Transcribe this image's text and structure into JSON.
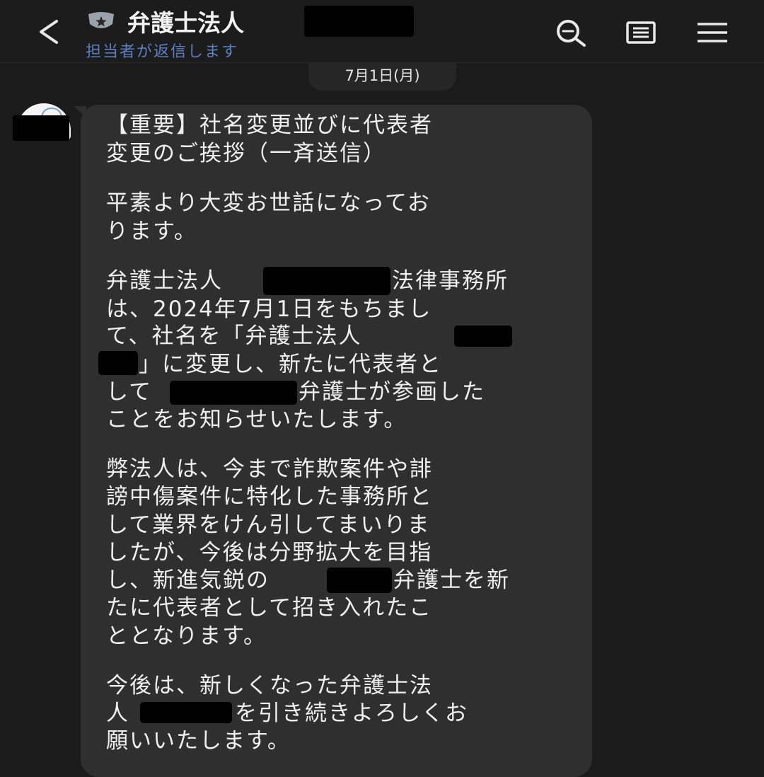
{
  "header": {
    "title": "弁護士法人",
    "subtitle": "担当者が返信します",
    "icons": [
      "chevron-left-icon",
      "shield-star-icon",
      "search-icon",
      "notes-icon",
      "menu-icon"
    ]
  },
  "date_divider": "7月1日(月)",
  "message": {
    "lines": [
      "【重要】社名変更並びに代表者",
      "変更のご挨拶（一斉送信）",
      "平素より大変お世話になってお",
      "ります。",
      "弁護士法人",
      "法律事務所",
      "は、2024年7月1日をもちまし",
      "て、社名を「弁護士法人",
      "」に変更し、新たに代表者と",
      "して",
      "弁護士が参画した",
      "ことをお知らせいたします。",
      "弊法人は、今まで詐欺案件や誹",
      "謗中傷案件に特化した事務所と",
      "して業界をけん引してまいりま",
      "したが、今後は分野拡大を目指",
      "し、新進気鋭の",
      "弁護士を新",
      "たに代表者として招き入れたこ",
      "ととなります。",
      "今後は、新しくなった弁護士法",
      "人",
      "を引き続きよろしくお",
      "願いいたします。"
    ]
  },
  "colors": {
    "background": "#1b1b1b",
    "header": "#1c1c1c",
    "bubble": "#2f2f2f",
    "subtitle_link": "#5b7fc1",
    "text": "#efefef"
  }
}
